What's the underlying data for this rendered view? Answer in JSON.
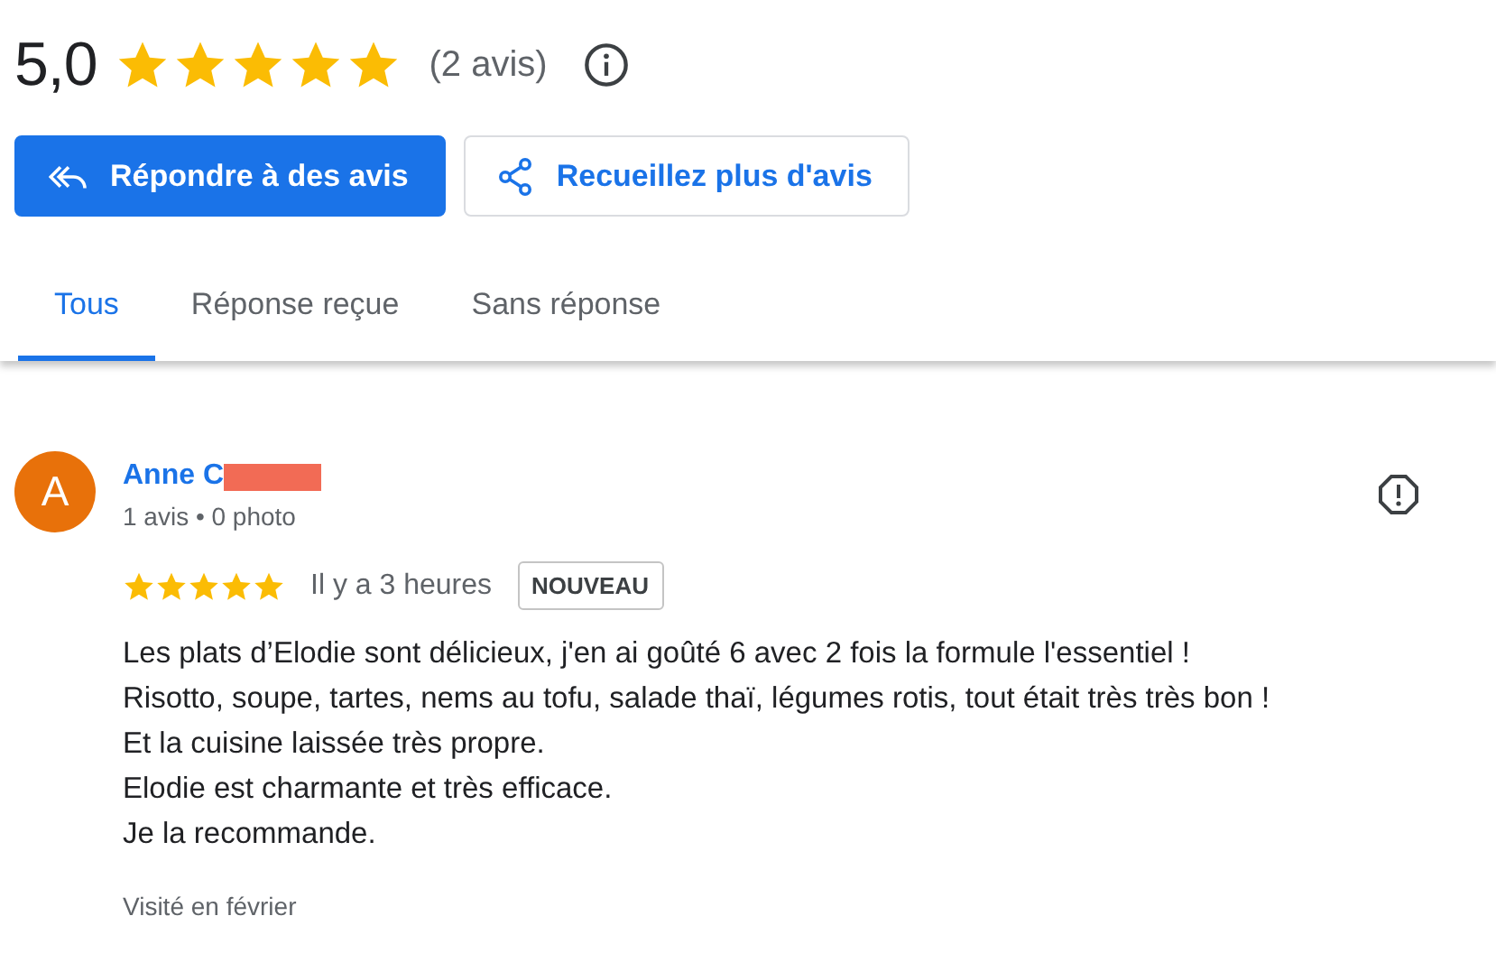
{
  "summary": {
    "rating": "5,0",
    "stars": 5,
    "count": "(2 avis)"
  },
  "buttons": [
    {
      "kind": "primary",
      "label": "Répondre à des avis"
    },
    {
      "kind": "secondary",
      "label": "Recueillez plus d'avis"
    }
  ],
  "tabs": [
    {
      "label": "Tous",
      "selected": true
    },
    {
      "label": "Réponse reçue",
      "selected": false
    },
    {
      "label": "Sans réponse",
      "selected": false
    }
  ],
  "review": {
    "initial": "A",
    "author": "Anne C",
    "redacted": true,
    "meta": "1 avis • 0 photo",
    "stars": 5,
    "time": "Il y a 3 heures",
    "badge": "NOUVEAU",
    "lines": [
      "Les plats d’Elodie sont délicieux, j'en ai goûté 6 avec 2 fois la formule l'essentiel !",
      "Risotto, soupe, tartes, nems au tofu, salade thaï, légumes rotis, tout était très très bon !",
      "Et la cuisine laissée très propre.",
      "Elodie est charmante et très efficace.",
      "Je la recommande."
    ],
    "visited": "Visité en février"
  }
}
